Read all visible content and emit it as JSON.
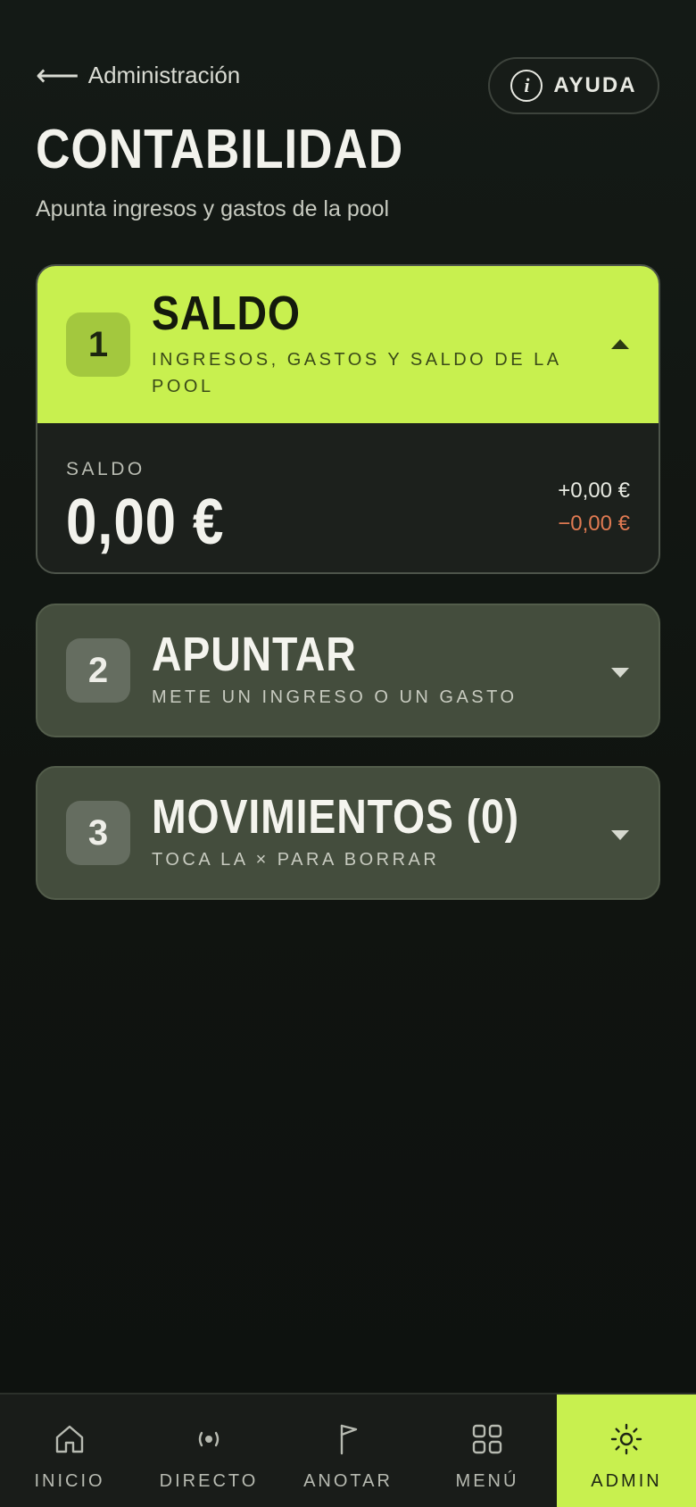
{
  "header": {
    "back_label": "Administración",
    "help_label": "AYUDA",
    "help_icon": "i",
    "title": "CONTABILIDAD",
    "subtitle": "Apunta ingresos y gastos de la pool"
  },
  "cards": [
    {
      "number": "1",
      "title": "SALDO",
      "subtitle": "INGRESOS, GASTOS Y SALDO DE LA POOL",
      "expanded": true,
      "balance_label": "SALDO",
      "balance_value": "0,00 €",
      "income": "+0,00 €",
      "expense": "−0,00 €"
    },
    {
      "number": "2",
      "title": "APUNTAR",
      "subtitle": "METE UN INGRESO O UN GASTO",
      "expanded": false
    },
    {
      "number": "3",
      "title": "MOVIMIENTOS (0)",
      "subtitle": "TOCA LA × PARA BORRAR",
      "expanded": false
    }
  ],
  "tabs": [
    {
      "label": "INICIO",
      "icon": "home-icon"
    },
    {
      "label": "DIRECTO",
      "icon": "live-icon"
    },
    {
      "label": "ANOTAR",
      "icon": "flag-icon"
    },
    {
      "label": "MENÚ",
      "icon": "grid-icon"
    },
    {
      "label": "ADMIN",
      "icon": "sun-icon",
      "active": true
    }
  ],
  "colors": {
    "accent": "#c8f04f",
    "background": "#111512",
    "card": "#444d3d",
    "expense": "#e07a52"
  }
}
